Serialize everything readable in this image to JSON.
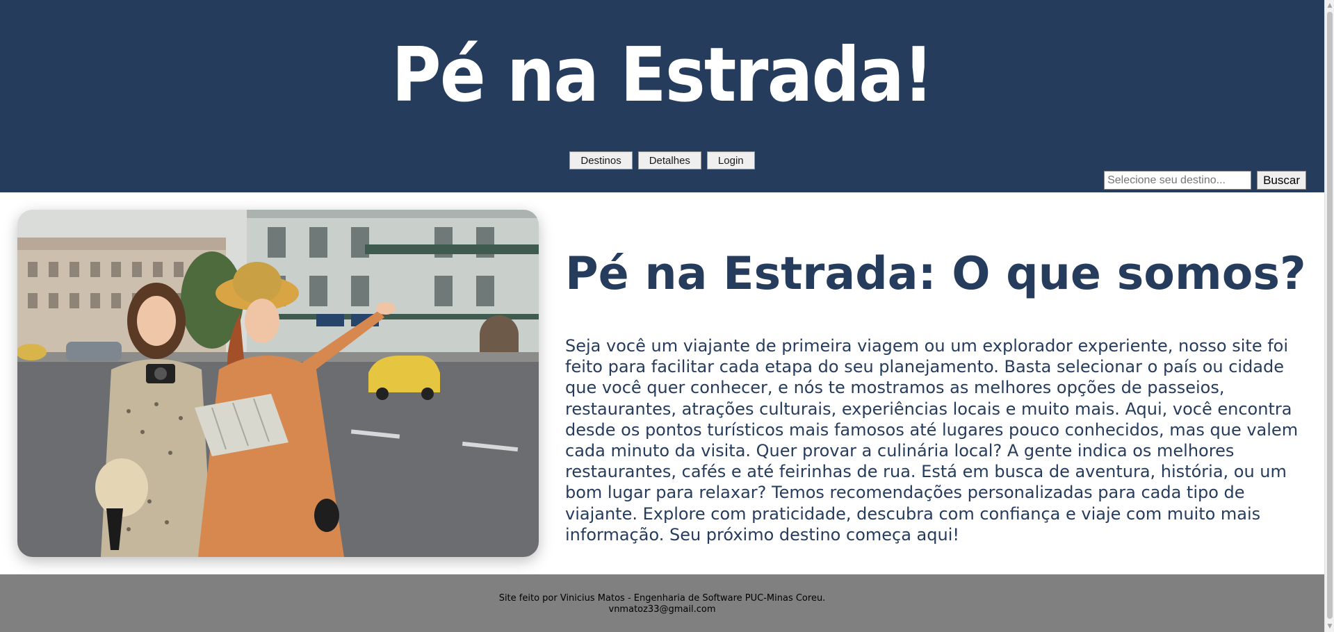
{
  "header": {
    "logo_text": "Pé na Estrada!",
    "nav": [
      {
        "label": "Destinos"
      },
      {
        "label": "Detalhes"
      },
      {
        "label": "Login"
      }
    ],
    "search": {
      "placeholder": "Selecione seu destino...",
      "button_label": "Buscar"
    }
  },
  "main": {
    "image_alt": "Duas viajantes com mapa e câmera em uma rua da cidade",
    "title": "Pé na Estrada: O que somos?",
    "paragraph": "Seja você um viajante de primeira viagem ou um explorador experiente, nosso site foi feito para facilitar cada etapa do seu planejamento. Basta selecionar o país ou cidade que você quer conhecer, e nós te mostramos as melhores opções de passeios, restaurantes, atrações culturais, experiências locais e muito mais. Aqui, você encontra desde os pontos turísticos mais famosos até lugares pouco conhecidos, mas que valem cada minuto da visita. Quer provar a culinária local? A gente indica os melhores restaurantes, cafés e até feirinhas de rua. Está em busca de aventura, história, ou um bom lugar para relaxar? Temos recomendações personalizadas para cada tipo de viajante. Explore com praticidade, descubra com confiança e viaje com muito mais informação. Seu próximo destino começa aqui!"
  },
  "footer": {
    "credit": "Site feito por Vinicius Matos - Engenharia de Software PUC-Minas Coreu.",
    "email": "vnmatoz33@gmail.com"
  },
  "colors": {
    "header_bg": "#263c5d",
    "accent_text": "#263c5d",
    "footer_bg": "#808080"
  }
}
